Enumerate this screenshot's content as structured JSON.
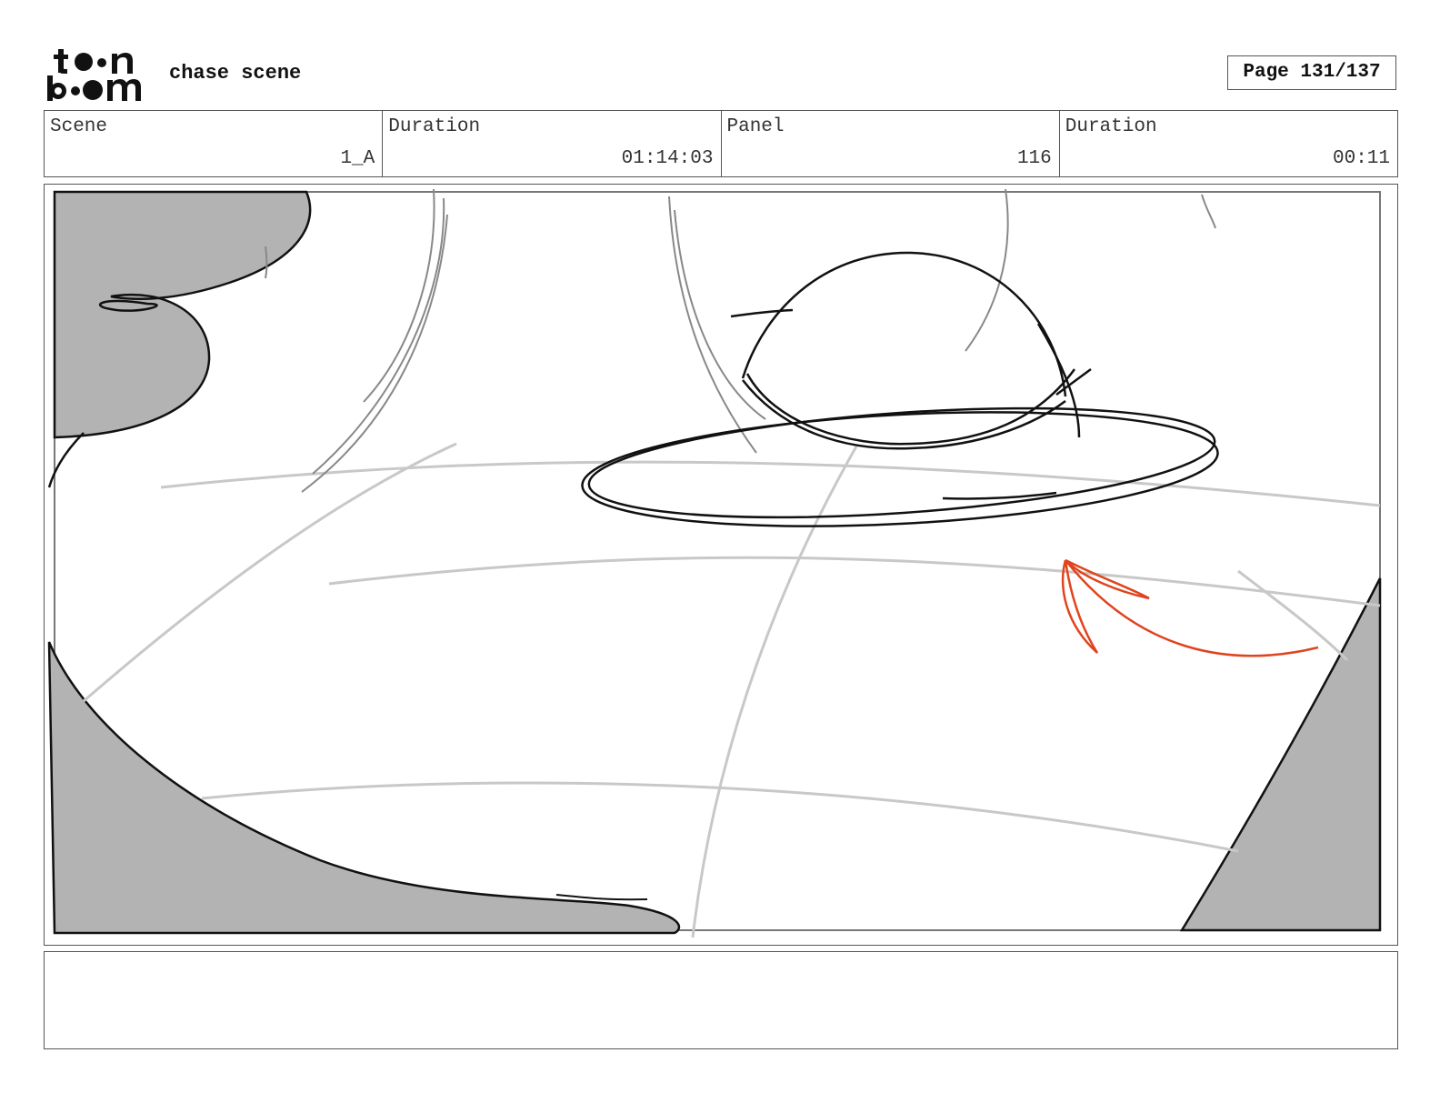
{
  "header": {
    "logo_text": "toon boom",
    "title": "chase scene",
    "page_label": "Page 131/137"
  },
  "info": {
    "scene_label": "Scene",
    "scene_value": "1_A",
    "scene_duration_label": "Duration",
    "scene_duration_value": "01:14:03",
    "panel_label": "Panel",
    "panel_value": "116",
    "panel_duration_label": "Duration",
    "panel_duration_value": "00:11"
  },
  "panel": {
    "shadow_color": "#b3b3b3",
    "line_color": "#111111",
    "guide_color": "#c8c8c8",
    "arrow_color": "#e0441e"
  },
  "notes": {
    "text": ""
  }
}
